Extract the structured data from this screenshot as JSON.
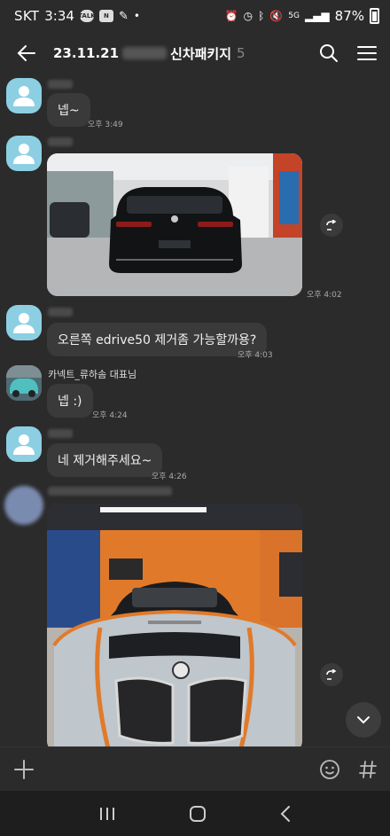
{
  "status_bar": {
    "carrier": "SKT",
    "time": "3:34",
    "notif_icons": [
      "talk-icon",
      "news-icon",
      "pin-icon"
    ],
    "battery": "87%",
    "signal_label": "5G"
  },
  "header": {
    "title_prefix": "23.11.21",
    "title_suffix": "신차패키지",
    "member_count": "5"
  },
  "messages": [
    {
      "text": "넵~",
      "time": "오후 3:49"
    },
    {
      "photo": "car-rear-showroom",
      "time": "오후 4:02"
    },
    {
      "text": "오른쪽 edrive50 제거좀 가능할까용?",
      "time": "오후 4:03"
    },
    {
      "sender": "카넥트_류하솜 대표님",
      "text": "넵 :)",
      "time": "오후 4:24"
    },
    {
      "text": "네 제거해주세요~",
      "time": "오후 4:26"
    },
    {
      "photo": "car-front-shop"
    }
  ],
  "colors": {
    "background": "#2b2b2b",
    "bubble": "#3a3a3a",
    "avatar": "#8ccfe3",
    "shop_orange": "#e07a2a"
  }
}
